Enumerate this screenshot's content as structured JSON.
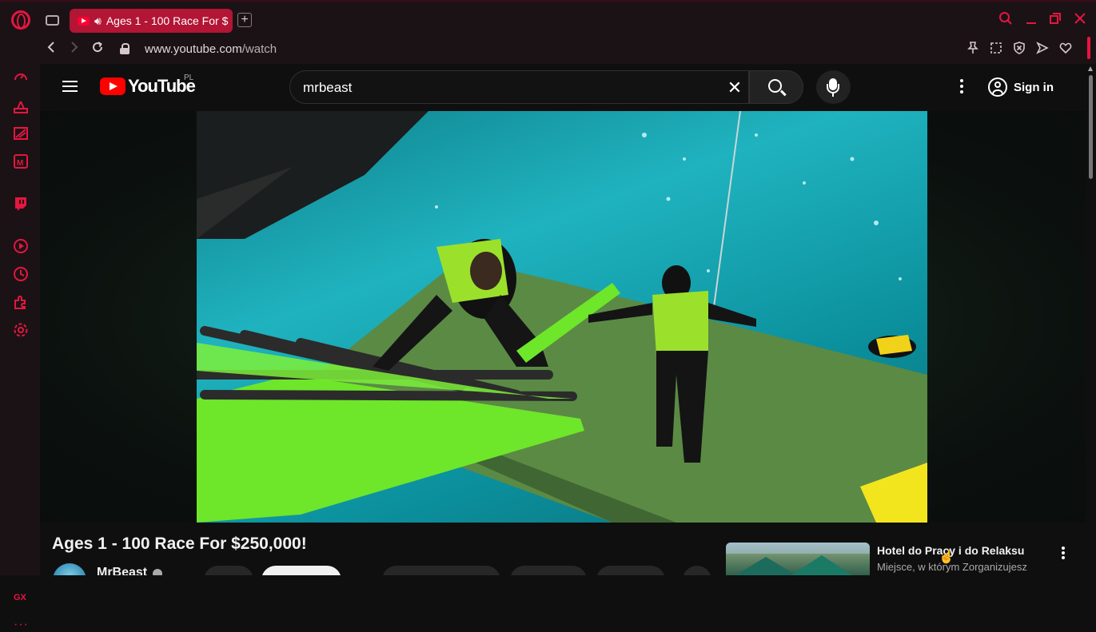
{
  "browser": {
    "tab_title": "Ages 1 - 100 Race For $",
    "new_tab_label": "+",
    "url_host": "www.youtube.com",
    "url_path": "/watch",
    "accent_color": "#e5163f",
    "icons": [
      "opera-logo-icon",
      "tabs-icon",
      "back-icon",
      "forward-icon",
      "reload-icon",
      "lock-icon",
      "pin-icon",
      "snapshot-icon",
      "adblock-icon",
      "share-icon",
      "heart-icon",
      "search-icon",
      "minimize-icon",
      "maximize-icon",
      "close-icon"
    ]
  },
  "sidebar": {
    "items": [
      "speed-dial-icon",
      "gx-control-icon",
      "gx-corner-icon",
      "messenger-icon",
      "twitch-icon",
      "player-icon",
      "history-icon",
      "extensions-icon",
      "settings-icon"
    ],
    "gx_label": "GX",
    "more_label": "···"
  },
  "youtube": {
    "logo_text": "YouTube",
    "country_code": "PL",
    "search": {
      "value": "mrbeast"
    },
    "signin_label": "Sign in",
    "video": {
      "title": "Ages 1 - 100 Race For $250,000!",
      "channel": "MrBeast"
    },
    "recommendation": {
      "title": "Hotel do Pracy i do Relaksu",
      "subtitle": "Miejsce, w którym Zorganizujesz"
    }
  }
}
